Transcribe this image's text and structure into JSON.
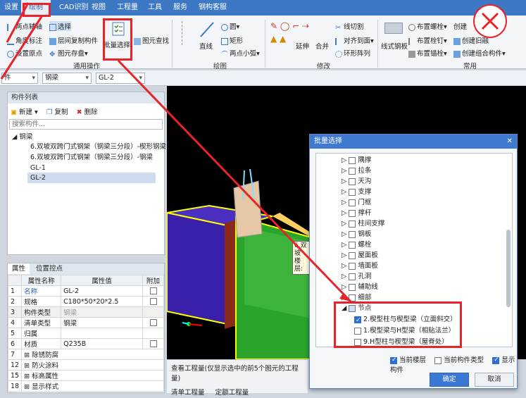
{
  "menubar": {
    "items": [
      "设置",
      "绘制",
      "CAD识别",
      "视图",
      "工程量",
      "工具",
      "服务",
      "钢构客服"
    ],
    "active": "绘制"
  },
  "ribbon": {
    "left_items": [
      "两点辅轴",
      "选择",
      "角度标注",
      "层间复制构件",
      "设置原点",
      "图元存盘"
    ],
    "group_general": "通用操作",
    "batch_select_label": "批量选择",
    "find_element_label": "图元查找",
    "draw_items": [
      "直线",
      "圆",
      "矩形",
      "两点小弧"
    ],
    "group_draw": "绘图",
    "modify_items": [
      "延伸",
      "合并",
      "线切割",
      "对齐到面",
      "环形阵列"
    ],
    "group_modify": "修改",
    "common_items": [
      "线式钢板",
      "布置螺栓",
      "布置栓钉",
      "布置锚栓",
      "创建",
      "创建旧融",
      "创建组合构件"
    ],
    "group_common": "常用"
  },
  "filterbar": {
    "combo1": "件",
    "combo2": "钢梁",
    "combo3": "GL-2"
  },
  "component_list": {
    "title": "构件列表",
    "new_label": "新建",
    "copy_label": "复制",
    "delete_label": "删除",
    "search_placeholder": "搜索构件...",
    "root": "钢梁",
    "items": [
      "6.双坡双跨门式钢架（钢梁三分段）-楔形钢梁",
      "6.双坡双跨门式钢架（钢梁三分段）-钢梁",
      "GL-1",
      "GL-2"
    ],
    "selected": "GL-2"
  },
  "props": {
    "tab_props": "属性",
    "tab_points": "位置控点",
    "col_name": "属性名称",
    "col_value": "属性值",
    "col_extra": "附加",
    "rows": [
      {
        "n": "1",
        "name": "名称",
        "value": "GL-2"
      },
      {
        "n": "2",
        "name": "规格",
        "value": "C180*50*20*2.5"
      },
      {
        "n": "3",
        "name": "构件类型",
        "value": "钢梁"
      },
      {
        "n": "4",
        "name": "清单类型",
        "value": "钢梁"
      },
      {
        "n": "5",
        "name": "归属",
        "value": ""
      },
      {
        "n": "6",
        "name": "材质",
        "value": "Q235B"
      },
      {
        "n": "7",
        "name": "除锈防腐",
        "value": ""
      },
      {
        "n": "12",
        "name": "防火涂料",
        "value": ""
      },
      {
        "n": "15",
        "name": "标高属性",
        "value": ""
      },
      {
        "n": "18",
        "name": "显示样式",
        "value": ""
      }
    ]
  },
  "viewport": {
    "tooltip_line1": "6.双坡",
    "tooltip_line2": "楼层:"
  },
  "quantity_panel": {
    "title": "查看工程量(仅显示选中的前5个图元的工程量)",
    "tab1": "清单工程量",
    "tab2": "定额工程量"
  },
  "dialog": {
    "title": "批量选择",
    "tree": [
      "隅撑",
      "拉条",
      "天沟",
      "支撑",
      "门框",
      "撑杆",
      "柱间支撑",
      "钢板",
      "螺栓",
      "屋面板",
      "墙面板",
      "孔洞",
      "辅助线",
      "细部"
    ],
    "node_label": "节点",
    "node_children": [
      {
        "label": "2.楔型柱与楔型梁（立面斜交）",
        "checked": true
      },
      {
        "label": "1.楔型梁与H型梁（相贴法兰）",
        "checked": false
      },
      {
        "label": "9.H型柱与楔型梁（屋脊处）",
        "checked": false
      }
    ],
    "opt_current_floor": "当前楼层",
    "opt_current_type": "当前构件类型",
    "opt_show_components": "显示构件",
    "ok_label": "确定",
    "cancel_label": "取消"
  },
  "colors": {
    "accent": "#3c78c4",
    "highlight": "#e8242a"
  }
}
